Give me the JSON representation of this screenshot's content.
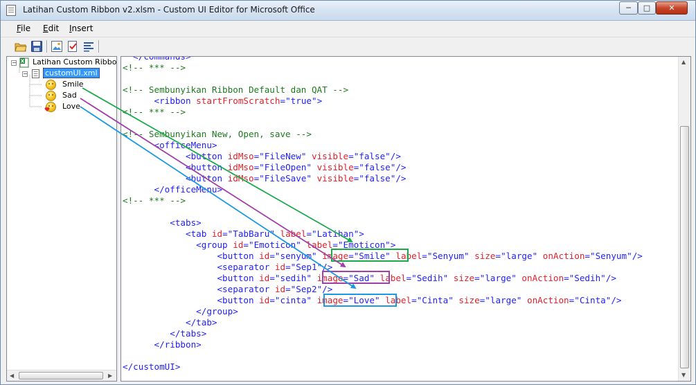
{
  "window": {
    "title": "Latihan Custom Ribbon v2.xlsm - Custom UI Editor for Microsoft Office"
  },
  "menu": [
    {
      "label": "File",
      "mnemonic": "F",
      "rest": "ile"
    },
    {
      "label": "Edit",
      "mnemonic": "E",
      "rest": "dit"
    },
    {
      "label": "Insert",
      "mnemonic": "I",
      "rest": "nsert"
    }
  ],
  "toolbar": {
    "icons": [
      "open-folder-icon",
      "save-icon",
      "insert-icons-icon",
      "validate-icon",
      "generate-callbacks-icon"
    ]
  },
  "tree": {
    "root": "Latihan Custom Ribbon v",
    "file": "customUI.xml",
    "images": [
      "Smile",
      "Sad",
      "Love"
    ]
  },
  "code_lines": [
    [
      [
        "c-tag",
        "  </commands>"
      ]
    ],
    [
      [
        "c-com",
        "<!-- *** -->"
      ]
    ],
    [],
    [
      [
        "c-com",
        "<!-- Sembunyikan Ribbon Default dan QAT -->"
      ]
    ],
    [
      [
        "c-tag",
        "      <ribbon "
      ],
      [
        "c-attr",
        "startFromScratch"
      ],
      [
        "c-punc",
        "="
      ],
      [
        "c-val",
        "\"true\""
      ],
      [
        "c-punc",
        ">"
      ]
    ],
    [
      [
        "c-com",
        "<!-- *** -->"
      ]
    ],
    [],
    [
      [
        "c-com",
        "<!-- Sembunyikan New, Open, save -->"
      ]
    ],
    [
      [
        "c-tag",
        "      <officeMenu>"
      ]
    ],
    [
      [
        "c-tag",
        "            <button "
      ],
      [
        "c-attr",
        "idMso"
      ],
      [
        "c-punc",
        "="
      ],
      [
        "c-val",
        "\"FileNew\""
      ],
      [
        "c-tag",
        " "
      ],
      [
        "c-attr",
        "visible"
      ],
      [
        "c-punc",
        "="
      ],
      [
        "c-val",
        "\"false\""
      ],
      [
        "c-punc",
        "/>"
      ]
    ],
    [
      [
        "c-tag",
        "            <button "
      ],
      [
        "c-attr",
        "idMso"
      ],
      [
        "c-punc",
        "="
      ],
      [
        "c-val",
        "\"FileOpen\""
      ],
      [
        "c-tag",
        " "
      ],
      [
        "c-attr",
        "visible"
      ],
      [
        "c-punc",
        "="
      ],
      [
        "c-val",
        "\"false\""
      ],
      [
        "c-punc",
        "/>"
      ]
    ],
    [
      [
        "c-tag",
        "            <button "
      ],
      [
        "c-attr",
        "idMso"
      ],
      [
        "c-punc",
        "="
      ],
      [
        "c-val",
        "\"FileSave\""
      ],
      [
        "c-tag",
        " "
      ],
      [
        "c-attr",
        "visible"
      ],
      [
        "c-punc",
        "="
      ],
      [
        "c-val",
        "\"false\""
      ],
      [
        "c-punc",
        "/>"
      ]
    ],
    [
      [
        "c-tag",
        "      </officeMenu>"
      ]
    ],
    [
      [
        "c-com",
        "<!-- *** -->"
      ]
    ],
    [],
    [
      [
        "c-tag",
        "         <tabs>"
      ]
    ],
    [
      [
        "c-tag",
        "            <tab "
      ],
      [
        "c-attr",
        "id"
      ],
      [
        "c-punc",
        "="
      ],
      [
        "c-val",
        "\"TabBaru\""
      ],
      [
        "c-tag",
        " "
      ],
      [
        "c-attr",
        "label"
      ],
      [
        "c-punc",
        "="
      ],
      [
        "c-val",
        "\"Latihan\""
      ],
      [
        "c-punc",
        ">"
      ]
    ],
    [
      [
        "c-tag",
        "              <group "
      ],
      [
        "c-attr",
        "id"
      ],
      [
        "c-punc",
        "="
      ],
      [
        "c-val",
        "\"Emoticon\""
      ],
      [
        "c-tag",
        " "
      ],
      [
        "c-attr",
        "label"
      ],
      [
        "c-punc",
        "="
      ],
      [
        "c-val",
        "\"Emoticon\""
      ],
      [
        "c-punc",
        ">"
      ]
    ],
    [
      [
        "c-tag",
        "                  <button "
      ],
      [
        "c-attr",
        "id"
      ],
      [
        "c-punc",
        "="
      ],
      [
        "c-val",
        "\"senyum\""
      ],
      [
        "c-tag",
        " "
      ],
      [
        "c-attr",
        "image"
      ],
      [
        "c-punc",
        "="
      ],
      [
        "c-val",
        "\"Smile\""
      ],
      [
        "c-tag",
        " "
      ],
      [
        "c-attr",
        "label"
      ],
      [
        "c-punc",
        "="
      ],
      [
        "c-val",
        "\"Senyum\""
      ],
      [
        "c-tag",
        " "
      ],
      [
        "c-attr",
        "size"
      ],
      [
        "c-punc",
        "="
      ],
      [
        "c-val",
        "\"large\""
      ],
      [
        "c-tag",
        " "
      ],
      [
        "c-attr",
        "onAction"
      ],
      [
        "c-punc",
        "="
      ],
      [
        "c-val",
        "\"Senyum\""
      ],
      [
        "c-punc",
        "/>"
      ]
    ],
    [
      [
        "c-tag",
        "                  <separator "
      ],
      [
        "c-attr",
        "id"
      ],
      [
        "c-punc",
        "="
      ],
      [
        "c-val",
        "\"Sep1\""
      ],
      [
        "c-punc",
        "/>"
      ]
    ],
    [
      [
        "c-tag",
        "                  <button "
      ],
      [
        "c-attr",
        "id"
      ],
      [
        "c-punc",
        "="
      ],
      [
        "c-val",
        "\"sedih\""
      ],
      [
        "c-tag",
        " "
      ],
      [
        "c-attr",
        "image"
      ],
      [
        "c-punc",
        "="
      ],
      [
        "c-val",
        "\"Sad\""
      ],
      [
        "c-tag",
        " "
      ],
      [
        "c-attr",
        "label"
      ],
      [
        "c-punc",
        "="
      ],
      [
        "c-val",
        "\"Sedih\""
      ],
      [
        "c-tag",
        " "
      ],
      [
        "c-attr",
        "size"
      ],
      [
        "c-punc",
        "="
      ],
      [
        "c-val",
        "\"large\""
      ],
      [
        "c-tag",
        " "
      ],
      [
        "c-attr",
        "onAction"
      ],
      [
        "c-punc",
        "="
      ],
      [
        "c-val",
        "\"Sedih\""
      ],
      [
        "c-punc",
        "/>"
      ]
    ],
    [
      [
        "c-tag",
        "                  <separator "
      ],
      [
        "c-attr",
        "id"
      ],
      [
        "c-punc",
        "="
      ],
      [
        "c-val",
        "\"Sep2\""
      ],
      [
        "c-punc",
        "/>"
      ]
    ],
    [
      [
        "c-tag",
        "                  <button "
      ],
      [
        "c-attr",
        "id"
      ],
      [
        "c-punc",
        "="
      ],
      [
        "c-val",
        "\"cinta\""
      ],
      [
        "c-tag",
        " "
      ],
      [
        "c-attr",
        "image"
      ],
      [
        "c-punc",
        "="
      ],
      [
        "c-val",
        "\"Love\""
      ],
      [
        "c-tag",
        " "
      ],
      [
        "c-attr",
        "label"
      ],
      [
        "c-punc",
        "="
      ],
      [
        "c-val",
        "\"Cinta\""
      ],
      [
        "c-tag",
        " "
      ],
      [
        "c-attr",
        "size"
      ],
      [
        "c-punc",
        "="
      ],
      [
        "c-val",
        "\"large\""
      ],
      [
        "c-tag",
        " "
      ],
      [
        "c-attr",
        "onAction"
      ],
      [
        "c-punc",
        "="
      ],
      [
        "c-val",
        "\"Cinta\""
      ],
      [
        "c-punc",
        "/>"
      ]
    ],
    [
      [
        "c-tag",
        "              </group>"
      ]
    ],
    [
      [
        "c-tag",
        "            </tab>"
      ]
    ],
    [
      [
        "c-tag",
        "         </tabs>"
      ]
    ],
    [
      [
        "c-tag",
        "      </ribbon>"
      ]
    ],
    [],
    [
      [
        "c-tag",
        "</customUI>"
      ]
    ]
  ],
  "highlights": [
    {
      "name": "smile",
      "color": "#1aaa4a"
    },
    {
      "name": "sad",
      "color": "#a040a8"
    },
    {
      "name": "love",
      "color": "#1a9ae0"
    }
  ],
  "colors": {
    "comment": "#1d7a1d",
    "tag": "#2020ff",
    "attribute": "#e0202a",
    "value": "#2020ff"
  }
}
